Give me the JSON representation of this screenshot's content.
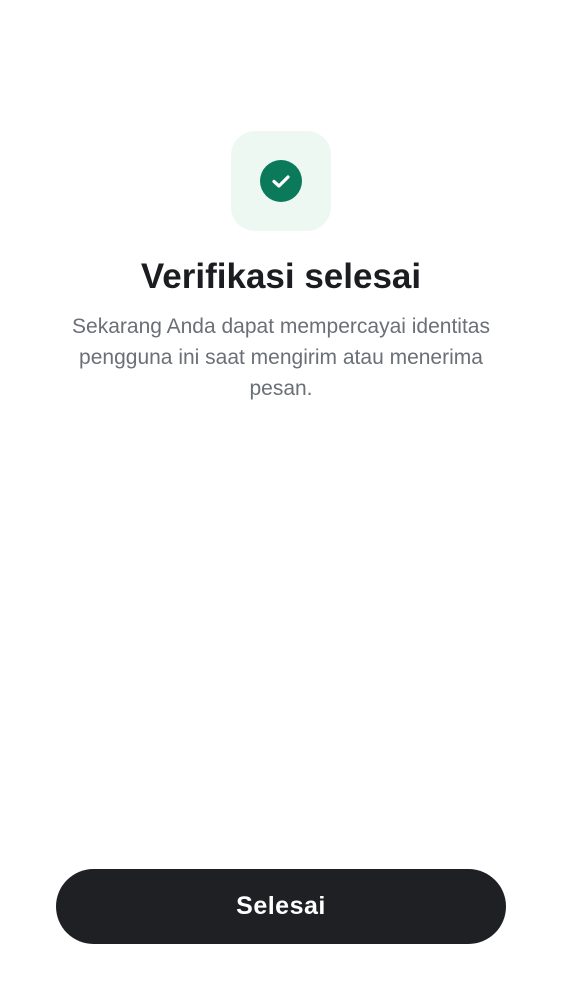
{
  "icon": {
    "name": "check-circle-icon",
    "badge_color": "#eef8f3",
    "circle_color": "#0b7a5a"
  },
  "title": "Verifikasi selesai",
  "description": "Sekarang Anda dapat mempercayai identitas pengguna ini saat mengirim atau menerima pesan.",
  "done_button": {
    "label": "Selesai",
    "color": "#1f2024"
  }
}
